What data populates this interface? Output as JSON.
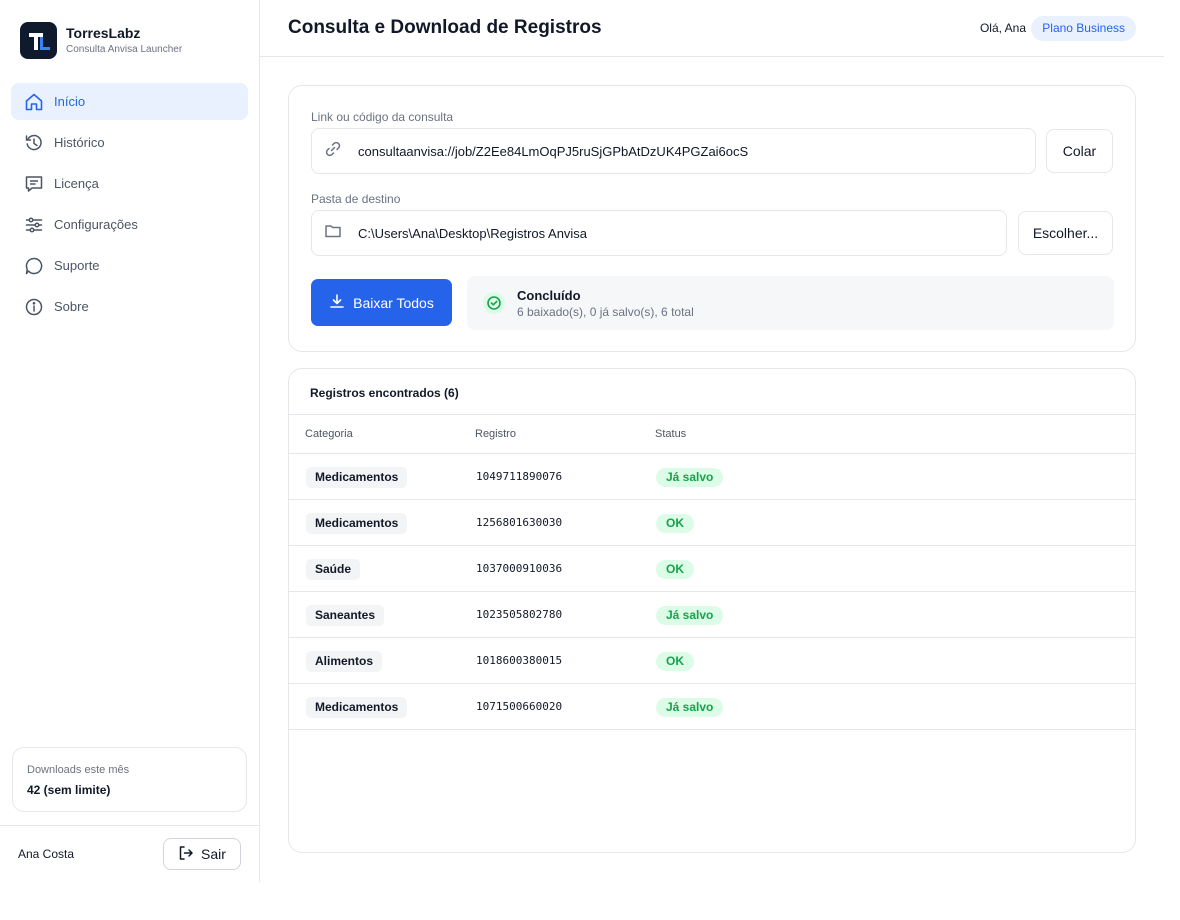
{
  "brand": {
    "name": "TorresLabz",
    "subtitle": "Consulta Anvisa Launcher"
  },
  "sidebar": {
    "items": [
      {
        "label": "Início",
        "icon": "home-icon",
        "active": true
      },
      {
        "label": "Histórico",
        "icon": "history-icon",
        "active": false
      },
      {
        "label": "Licença",
        "icon": "license-icon",
        "active": false
      },
      {
        "label": "Configurações",
        "icon": "sliders-icon",
        "active": false
      },
      {
        "label": "Suporte",
        "icon": "chat-icon",
        "active": false
      },
      {
        "label": "Sobre",
        "icon": "info-icon",
        "active": false
      }
    ],
    "usage": {
      "label": "Downloads este mês",
      "value": "42 (sem limite)"
    },
    "user": "Ana Costa",
    "logout_label": "Sair"
  },
  "header": {
    "title": "Consulta e Download de Registros",
    "greeting": "Olá, Ana",
    "plan": "Plano Business"
  },
  "form": {
    "link_label": "Link ou código da consulta",
    "link_value": "consultaanvisa://job/Z2Ee84LmOqPJ5ruSjGPbAtDzUK4PGZai6ocS",
    "paste_label": "Colar",
    "folder_label": "Pasta de destino",
    "folder_value": "C:\\Users\\Ana\\Desktop\\Registros Anvisa",
    "choose_label": "Escolher...",
    "download_label": "Baixar Todos"
  },
  "status": {
    "title": "Concluído",
    "detail": "6 baixado(s), 0 já salvo(s), 6 total"
  },
  "table": {
    "title": "Registros encontrados (6)",
    "columns": [
      "Categoria",
      "Registro",
      "Status"
    ],
    "rows": [
      {
        "categoria": "Medicamentos",
        "registro": "1049711890076",
        "status": "Já salvo"
      },
      {
        "categoria": "Medicamentos",
        "registro": "1256801630030",
        "status": "OK"
      },
      {
        "categoria": "Saúde",
        "registro": "1037000910036",
        "status": "OK"
      },
      {
        "categoria": "Saneantes",
        "registro": "1023505802780",
        "status": "Já salvo"
      },
      {
        "categoria": "Alimentos",
        "registro": "1018600380015",
        "status": "OK"
      },
      {
        "categoria": "Medicamentos",
        "registro": "1071500660020",
        "status": "Já salvo"
      }
    ]
  },
  "colors": {
    "accent": "#2563eb",
    "accent_light": "#eaf1fe",
    "success": "#16a34a",
    "success_bg": "#dcfce7",
    "logo_bg": "#0f1b2d"
  }
}
